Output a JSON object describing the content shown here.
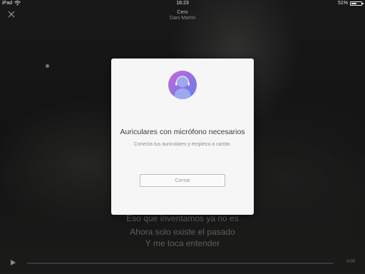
{
  "status_bar": {
    "device": "iPad",
    "time": "16:23",
    "battery_percent": "51%",
    "battery_level": 0.51
  },
  "player": {
    "song_title": "Cero",
    "artist": "Dani Martín",
    "lyrics": [
      "Eso que inventamos ya no es",
      "Ahora solo existe el pasado",
      "Y me toca entender"
    ],
    "time_remaining": "0:00",
    "progress": 0
  },
  "modal": {
    "title": "Auriculares con micrófono necesarios",
    "subtitle": "Conecta tus auriculares y empieza a cantar.",
    "close_label": "Cerrar"
  },
  "icons": {
    "close": "close-icon",
    "wifi": "wifi-icon",
    "battery": "battery-icon",
    "play": "play-icon",
    "avatar": "headphone-user-icon"
  },
  "colors": {
    "modal_background": "#f6f6f6",
    "avatar_gradient_start": "#c86bd7",
    "avatar_gradient_end": "#5f86e8",
    "button_border": "#bdbdbd"
  }
}
